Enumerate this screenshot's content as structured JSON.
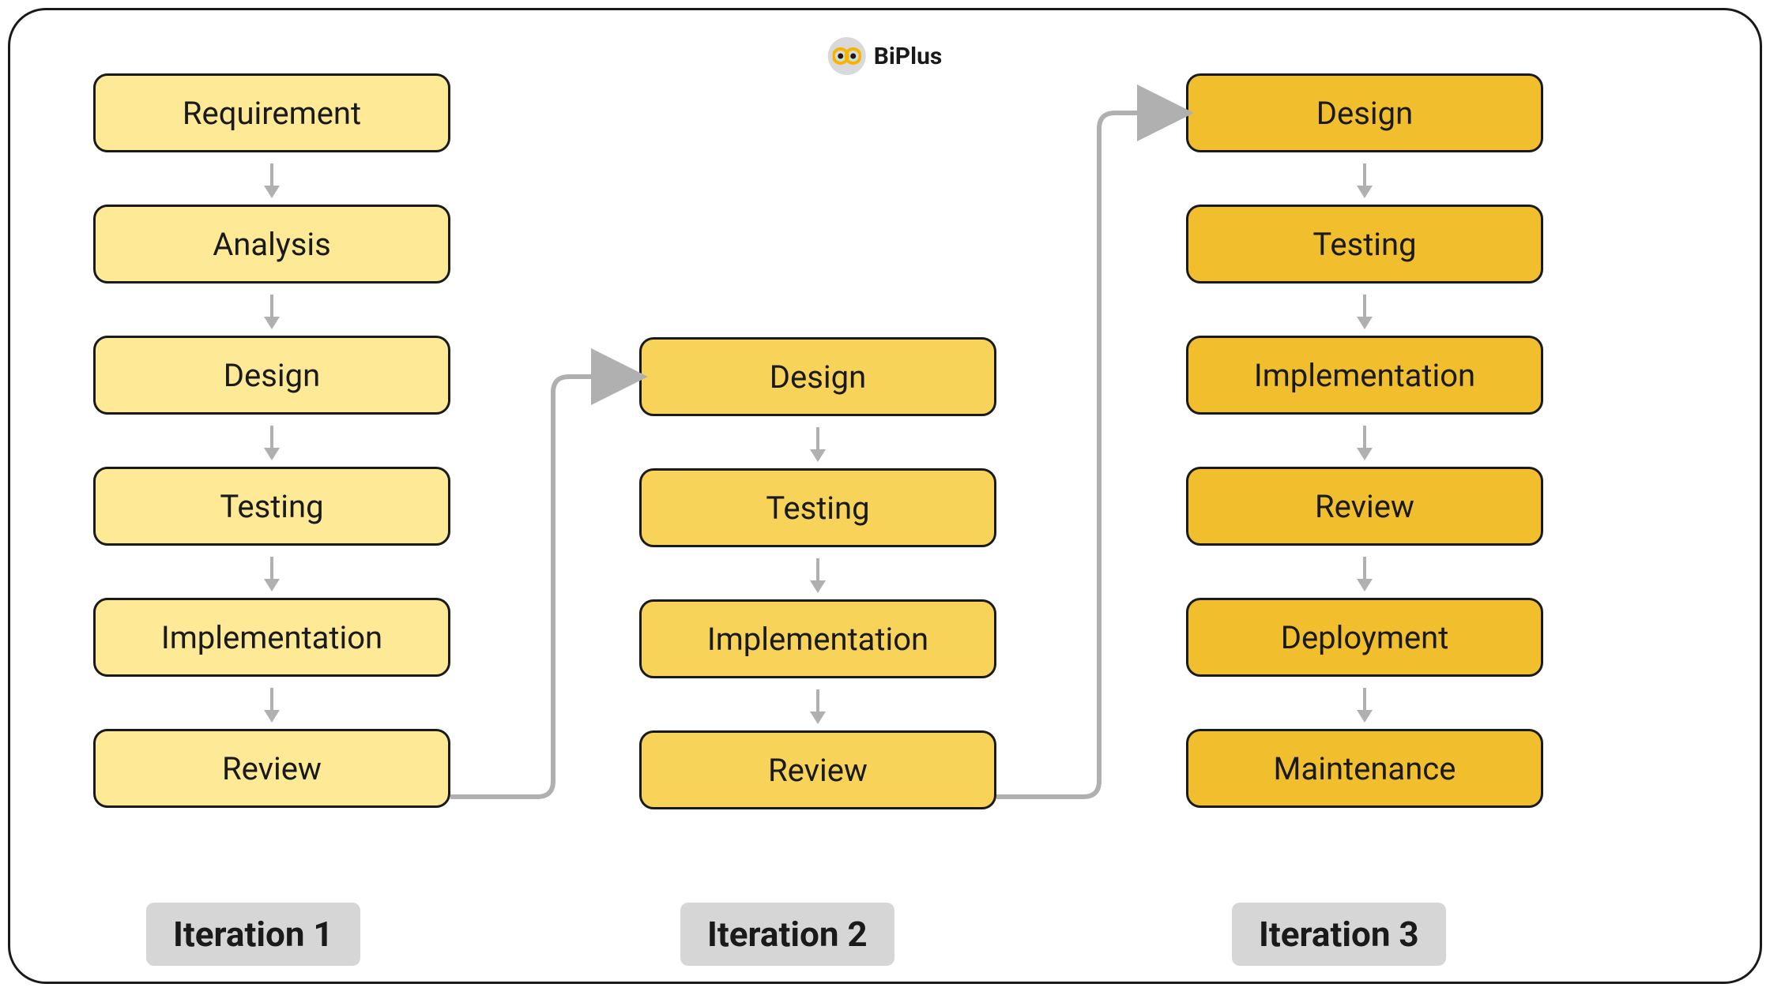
{
  "logo": {
    "name": "BiPlus"
  },
  "columns": [
    {
      "label": "Iteration 1",
      "shade": "shade-1",
      "steps": [
        "Requirement",
        "Analysis",
        "Design",
        "Testing",
        "Implementation",
        "Review"
      ]
    },
    {
      "label": "Iteration 2",
      "shade": "shade-2",
      "steps": [
        "Design",
        "Testing",
        "Implementation",
        "Review"
      ]
    },
    {
      "label": "Iteration 3",
      "shade": "shade-3",
      "steps": [
        "Design",
        "Testing",
        "Implementation",
        "Review",
        "Deployment",
        "Maintenance"
      ]
    }
  ],
  "colors": {
    "shade1": "#fde996",
    "shade2": "#f7d35a",
    "shade3": "#f1be2d",
    "border": "#1a1a1a",
    "arrow": "#b0b0b0",
    "labelBg": "#d6d6d6"
  }
}
